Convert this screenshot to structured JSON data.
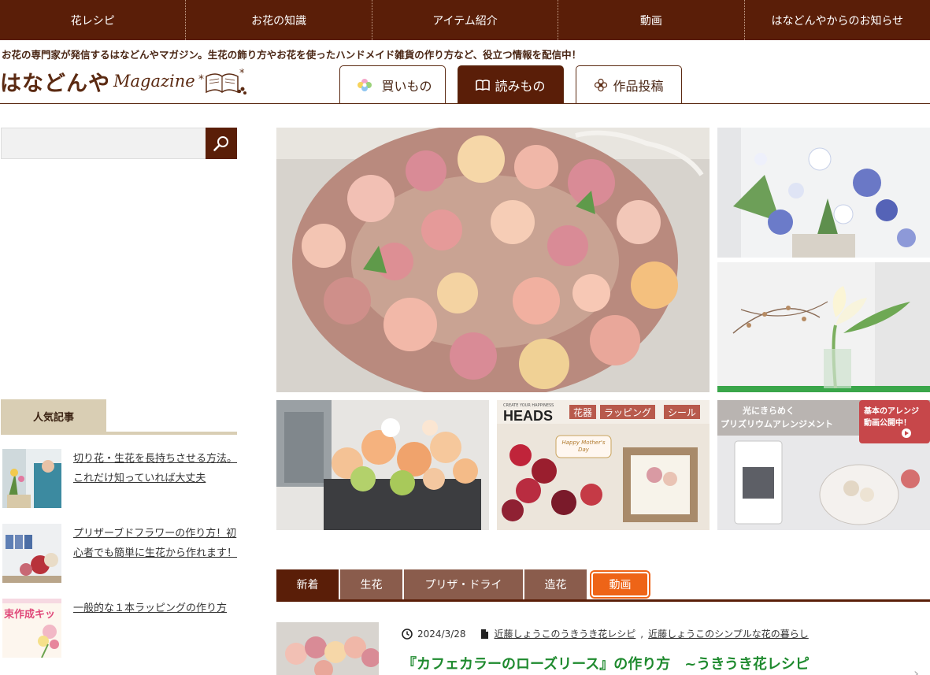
{
  "nav": {
    "items": [
      "花レシピ",
      "お花の知識",
      "アイテム紹介",
      "動画",
      "はなどんやからのお知らせ"
    ]
  },
  "header": {
    "tagline": "お花の専門家が発信するはなどんやマガジン。生花の飾り方やお花を使ったハンドメイド雑貨の作り方など、役立つ情報を配信中！",
    "logo_jp": "はなどんや",
    "logo_en": "Magazine",
    "tabs": [
      {
        "label": "買いもの",
        "icon": "flower-logo-icon"
      },
      {
        "label": "読みもの",
        "icon": "book-icon"
      },
      {
        "label": "作品投稿",
        "icon": "flower-outline-icon"
      }
    ]
  },
  "search": {
    "placeholder": "",
    "button_icon": "search-icon"
  },
  "popular": {
    "heading": "人気記事",
    "items": [
      {
        "title": "切り花・生花を長持ちさせる方法。これだけ知っていれば大丈夫"
      },
      {
        "title": "プリザーブドフラワーの作り方！初心者でも簡単に生花から作れます！"
      },
      {
        "title": "一般的な１本ラッピングの作り方",
        "thumb_text": "束作成キッ"
      }
    ]
  },
  "banners": {
    "heads_sub": "CREATE YOUR HAPPINESS",
    "heads_title": "HEADS",
    "heads_badges": [
      "花器",
      "ラッピング",
      "シール"
    ],
    "heads_card": "Happy Mother's Day",
    "prism_line1": "光にきらめく",
    "prism_line2": "プリズリウムアレンジメント",
    "prism_badge_line1": "基本のアレンジ",
    "prism_badge_line2": "動画公開中！"
  },
  "categories": {
    "tabs": [
      "新着",
      "生花",
      "プリザ・ドライ",
      "造花",
      "動画"
    ]
  },
  "article": {
    "date": "2024/3/28",
    "category1": "近藤しょうこのうきうき花レシピ",
    "category2": "近藤しょうこのシンプルな花の暮らし",
    "title": "『カフェカラーのローズリース』の作り方　~うきうき花レシピ"
  },
  "colors": {
    "brand_brown": "#5a1e08",
    "tab_brown": "#8a5c4c",
    "video_orange": "#ee6417",
    "popular_beige": "#d9ceb4",
    "title_green": "#1e8a2e"
  }
}
